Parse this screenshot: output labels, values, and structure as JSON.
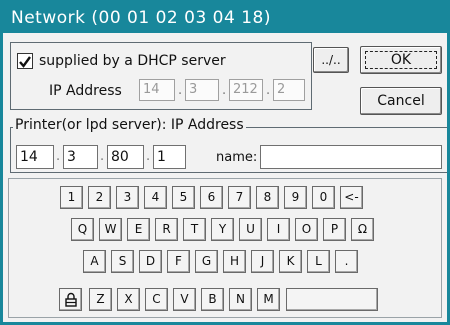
{
  "window": {
    "title": "Network (00 01 02 03 04 18)"
  },
  "dhcp": {
    "checkbox_label": "supplied by a DHCP server",
    "checked": true,
    "ip_label": "IP Address",
    "ip": [
      "14",
      "3",
      "212",
      "2"
    ],
    "browse_label": "../.."
  },
  "buttons": {
    "ok": "OK",
    "cancel": "Cancel"
  },
  "printer": {
    "legend": "Printer(or lpd server): IP Address",
    "ip": [
      "14",
      "3",
      "80",
      "1"
    ],
    "name_label": "name:",
    "name_value": ""
  },
  "keyboard": {
    "row1": [
      "1",
      "2",
      "3",
      "4",
      "5",
      "6",
      "7",
      "8",
      "9",
      "0",
      "<-"
    ],
    "row2": [
      "Q",
      "W",
      "E",
      "R",
      "T",
      "Y",
      "U",
      "I",
      "O",
      "P",
      "Ω"
    ],
    "row3": [
      "A",
      "S",
      "D",
      "F",
      "G",
      "H",
      "J",
      "K",
      "L",
      "."
    ],
    "row4": [
      "Z",
      "X",
      "C",
      "V",
      "B",
      "N",
      "M"
    ],
    "shift_icon": "lock-icon",
    "space_label": ""
  }
}
